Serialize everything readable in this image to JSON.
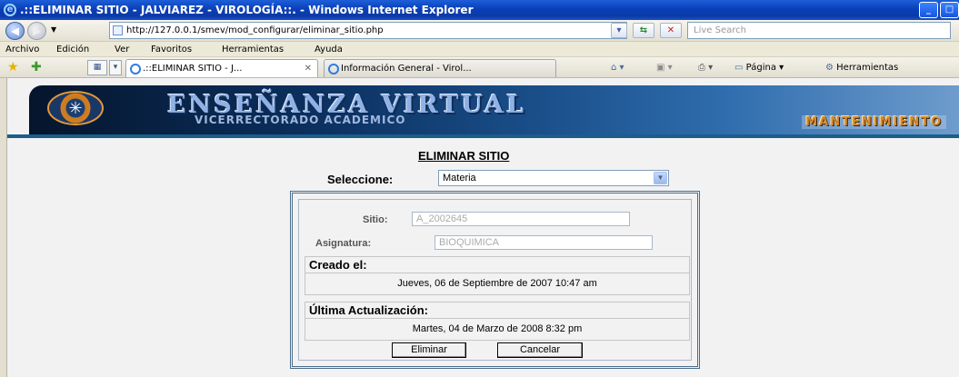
{
  "window": {
    "title": ".::ELIMINAR SITIO - JALVIAREZ - VIROLOGÍA::. - Windows Internet Explorer"
  },
  "address_bar": {
    "url": "http://127.0.0.1/smev/mod_configurar/eliminar_sitio.php",
    "search_placeholder": "Live Search"
  },
  "menu": {
    "items": [
      "Archivo",
      "Edición",
      "Ver",
      "Favoritos",
      "Herramientas",
      "Ayuda"
    ]
  },
  "tabs": {
    "items": [
      {
        "label": ".::ELIMINAR SITIO - J..."
      },
      {
        "label": "Información General - Virol..."
      }
    ],
    "commands": {
      "page": "Página",
      "tools": "Herramientas"
    }
  },
  "banner": {
    "title": "ENSEÑANZA VIRTUAL",
    "subtitle": "VICERRECTORADO ACADEMICO",
    "section_tag": "MANTENIMIENTO"
  },
  "form": {
    "heading": "ELIMINAR SITIO",
    "select_label": "Seleccione:",
    "select_value": "Materia",
    "site_label": "Sitio:",
    "site_value": "A_2002645",
    "subject_label": "Asignatura:",
    "subject_value": "BIOQUIMICA",
    "created_label": "Creado el:",
    "created_value": "Jueves, 06 de Septiembre de 2007 10:47 am",
    "updated_label": "Última Actualización:",
    "updated_value": "Martes, 04 de Marzo de 2008 8:32 pm",
    "delete_button": "Eliminar",
    "cancel_button": "Cancelar"
  }
}
